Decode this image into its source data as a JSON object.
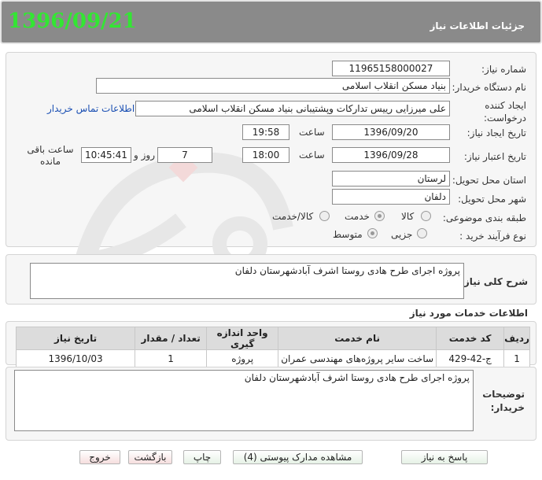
{
  "header": {
    "title": "جزئیات اطلاعات نیاز",
    "date": "1396/09/21"
  },
  "form": {
    "need_number": {
      "label": "شماره نیاز:",
      "value": "1196515800002​7"
    },
    "buyer_org": {
      "label": "نام دستگاه خریدار:",
      "value": "بنیاد مسکن انقلاب اسلامی"
    },
    "requester": {
      "label": "ایجاد کننده درخواست:",
      "value": "علی میرزایی رییس تدارکات وپشتیبانی بنیاد مسکن انقلاب اسلامی",
      "contact_link": "اطلاعات تماس خریدار"
    },
    "created": {
      "label": "تاریخ ایجاد نیاز:",
      "date": "1396/09/20",
      "time_label": "ساعت",
      "time": "19:58"
    },
    "validity": {
      "label": "تاریخ اعتبار نیاز:",
      "date": "1396/09/28",
      "time_label": "ساعت",
      "time": "18:00",
      "days": "7",
      "days_label": "روز و",
      "remaining_time": "10:45:41",
      "remaining_label": "ساعت باقی مانده"
    },
    "province": {
      "label": "استان محل تحویل:",
      "value": "لرستان"
    },
    "city": {
      "label": "شهر محل تحویل:",
      "value": "دلفان"
    },
    "category": {
      "label": "طبقه بندی موضوعی:",
      "options": [
        "کالا",
        "خدمت",
        "کالا/خدمت"
      ],
      "selected": "خدمت"
    },
    "process": {
      "label": "نوع فرآیند خرید :",
      "options": [
        "جزیی",
        "متوسط"
      ],
      "selected": "متوسط"
    }
  },
  "summary": {
    "label": "شرح کلی نیاز:",
    "text": "پروژه اجرای طرح هادی روستا اشرف آبادشهرستان دلفان"
  },
  "services": {
    "title": "اطلاعات خدمات مورد نیاز",
    "columns": [
      "ردیف",
      "کد خدمت",
      "نام خدمت",
      "واحد اندازه گیری",
      "تعداد / مقدار",
      "تاریخ نیاز"
    ],
    "rows": [
      {
        "row": "1",
        "code": "ج-42-429",
        "name": "ساخت سایر پروژه‌های مهندسی عمران",
        "unit": "پروژه",
        "qty": "1",
        "date": "1396/10/03"
      }
    ]
  },
  "buyer_notes": {
    "label_line1": "توضیحات",
    "label_line2": "خریدار:",
    "text": "پروژه اجرای طرح هادی روستا اشرف آبادشهرستان دلفان"
  },
  "buttons": {
    "reply": "پاسخ به نیاز",
    "attachments": "مشاهده مدارک پیوستی (4)",
    "print": "چاپ",
    "back": "بازگشت",
    "exit": "خروج"
  },
  "watermark": {
    "text": "هزاره",
    "sub": "گستران رتبط"
  }
}
